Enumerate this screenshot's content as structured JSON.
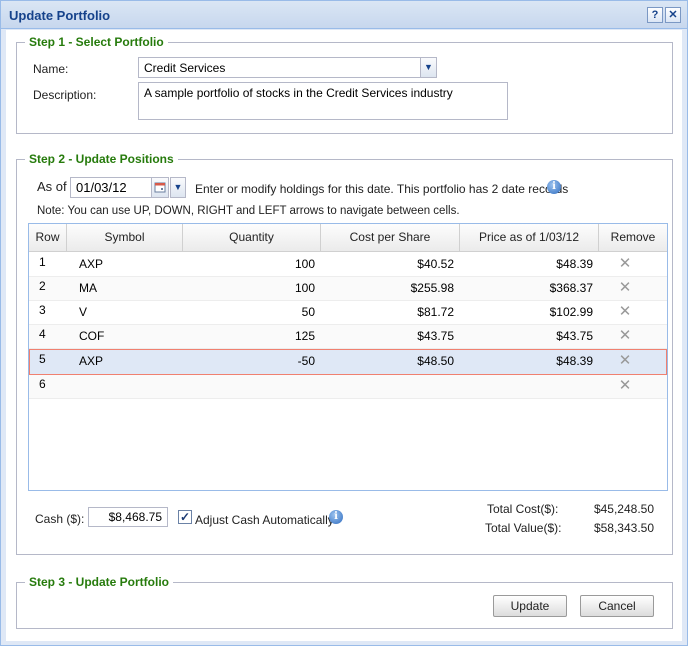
{
  "window": {
    "title": "Update Portfolio",
    "help_glyph": "?",
    "close_glyph": "✕"
  },
  "step1": {
    "legend": "Step 1 - Select Portfolio",
    "name_label": "Name:",
    "name_value": "Credit Services",
    "description_label": "Description:",
    "description_value": "A sample portfolio of stocks in the Credit Services industry"
  },
  "step2": {
    "legend": "Step 2 - Update Positions",
    "as_of_label": "As of",
    "date_value": "01/03/12",
    "info_text": "Enter or modify holdings for this date. This portfolio has 2 date records",
    "note": "Note: You can use UP, DOWN, RIGHT and LEFT arrows to navigate between cells.",
    "columns": [
      "Row",
      "Symbol",
      "Quantity",
      "Cost per Share",
      "Price as of 1/03/12",
      "Remove"
    ],
    "rows": [
      {
        "row": "1",
        "symbol": "AXP",
        "quantity": "100",
        "cost": "$40.52",
        "price": "$48.39"
      },
      {
        "row": "2",
        "symbol": "MA",
        "quantity": "100",
        "cost": "$255.98",
        "price": "$368.37"
      },
      {
        "row": "3",
        "symbol": "V",
        "quantity": "50",
        "cost": "$81.72",
        "price": "$102.99"
      },
      {
        "row": "4",
        "symbol": "COF",
        "quantity": "125",
        "cost": "$43.75",
        "price": "$43.75"
      },
      {
        "row": "5",
        "symbol": "AXP",
        "quantity": "-50",
        "cost": "$48.50",
        "price": "$48.39"
      },
      {
        "row": "6",
        "symbol": "",
        "quantity": "",
        "cost": "",
        "price": ""
      }
    ],
    "selected_row": 5,
    "cash_label": "Cash ($):",
    "cash_value": "$8,468.75",
    "adjust_cash_label": "Adjust Cash Automatically",
    "adjust_cash_checked": true,
    "total_cost_label": "Total Cost($):",
    "total_cost_value": "$45,248.50",
    "total_value_label": "Total Value($):",
    "total_value_value": "$58,343.50"
  },
  "step3": {
    "legend": "Step 3 - Update Portfolio",
    "update_label": "Update",
    "cancel_label": "Cancel"
  },
  "icons": {
    "remove": "close-x-icon",
    "info": "info-icon",
    "calendar": "calendar-icon",
    "dropdown": "chevron-down-icon"
  },
  "colors": {
    "legend": "#267b0c",
    "title": "#15428b",
    "selected_row_border": "#f08070",
    "selected_row_bg": "#dfe8f6"
  }
}
